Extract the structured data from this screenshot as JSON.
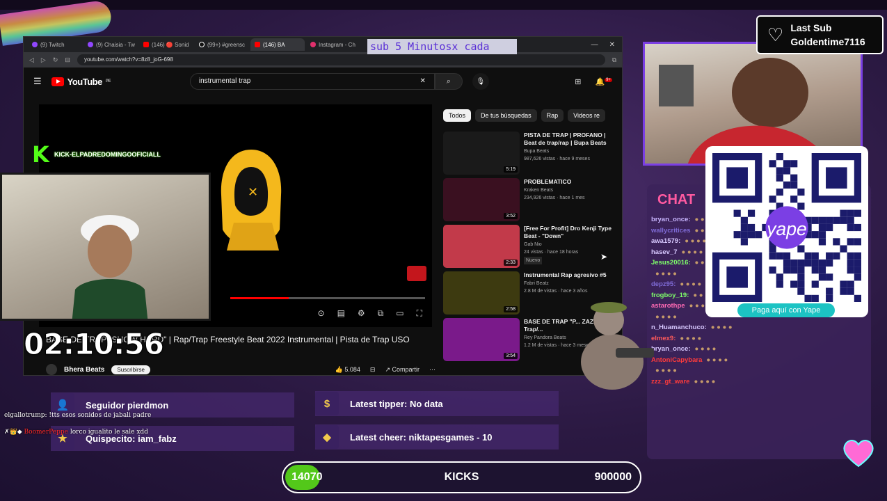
{
  "browser": {
    "tabs": [
      {
        "label": "(9) Twitch",
        "kind": "twitch"
      },
      {
        "label": "(9) Chaisia - Tw",
        "kind": "twitch"
      },
      {
        "label": "(146) 🔴 Sonid",
        "kind": "yt"
      },
      {
        "label": "(99+) #greensc",
        "kind": "tk"
      },
      {
        "label": "(146) BA",
        "kind": "yt",
        "active": true
      },
      {
        "label": "Instagram - Ch",
        "kind": "ig"
      }
    ],
    "url": "youtube.com/watch?v=8z8_joG-698",
    "overlay_text": "sub 5 Minutosx cada"
  },
  "youtube": {
    "logo_text": "YouTube",
    "logo_region": "PE",
    "search_value": "instrumental trap",
    "notification_count": "9+",
    "video_title": "BASE DE TRAP \"SHOW HARD\" | Rap/Trap Freestyle Beat 2022 Instrumental | Pista de Trap USO",
    "channel_name": "Bhera Beats",
    "subscribe_label": "Suscribirse",
    "likes": "5.084",
    "share_label": "Compartir",
    "chips": [
      "Todos",
      "De tus búsquedas",
      "Rap",
      "Videos re"
    ],
    "recommendations": [
      {
        "title": "PISTA DE TRAP | PROFANO | Beat de trap/rap | Bupa Beats",
        "channel": "Bupa Beats",
        "meta": "987,626 vistas · hace 9 meses",
        "duration": "5:19",
        "color": "#1a1a1a"
      },
      {
        "title": "PROBLEMATICO",
        "channel": "Kraken Beats",
        "meta": "234,926 vistas · hace 1 mes",
        "duration": "3:52",
        "color": "#3a1020"
      },
      {
        "title": "[Free For Profit] Dro Kenji Type Beat - \"Down\"",
        "channel": "Gab Nio",
        "meta": "24 vistas · hace 18 horas",
        "duration": "2:33",
        "color": "#c23a4a",
        "badge": "Nuevo"
      },
      {
        "title": "Instrumental Rap agresivo #5",
        "channel": "Fabri Beatz",
        "meta": "2.8 M de vistas · hace 3 años",
        "duration": "2:58",
        "color": "#3d3a10"
      },
      {
        "title": "BASE DE TRAP \"P... ZAZA\" | Trap/...",
        "channel": "Rey Pandora Beats",
        "meta": "1.2 M de vistas · hace 3 meses",
        "duration": "3:54",
        "color": "#7a1a8a"
      }
    ]
  },
  "stream": {
    "kick_channel": "KICK-ELPADREDOMINGOOFICIALL",
    "timer": "02:10:56",
    "last_sub_label": "Last Sub",
    "last_sub_name": "Goldentime7116",
    "yape_label": "Paga aquí con Yape",
    "chat_title": "CHAT",
    "chat_lines": [
      {
        "user": "bryan_once:",
        "color": "#c9b6ff"
      },
      {
        "user": "wallycritices",
        "color": "#7f6bd6"
      },
      {
        "user": "awa1579:",
        "color": "#d8c9ff"
      },
      {
        "user": "hasev_7",
        "color": "#d8c9ff"
      },
      {
        "user": "Jesus20016:",
        "color": "#7fff6a"
      },
      {
        "user": "",
        "color": "#d8c9ff"
      },
      {
        "user": "depz95:",
        "color": "#7f6bd6"
      },
      {
        "user": "frogboy_19:",
        "color": "#7fff6a"
      },
      {
        "user": "astarothpe",
        "color": "#ff6ab4"
      },
      {
        "user": "",
        "color": "#d8c9ff"
      },
      {
        "user": "n_Huamanchuco:",
        "color": "#d8c9ff"
      },
      {
        "user": "elmex9:",
        "color": "#ff5a5a"
      },
      {
        "user": "bryan_once:",
        "color": "#d8c9ff"
      },
      {
        "user": "AntoniCapybara",
        "color": "#ff3b3b"
      },
      {
        "user": "",
        "color": "#d8c9ff"
      },
      {
        "user": "zzz_gt_ware",
        "color": "#ff3b3b"
      }
    ],
    "follower_text": "Seguidor pierdmon",
    "sub_text": "Quispecito: iam_fabz",
    "tipper_text": "Latest tipper: No data",
    "cheer_text": "Latest cheer: niktapesgames - 10",
    "overlay_chat_1": "elgallotrump: !tts esos sonidos de jabali padre",
    "overlay_chat_2_user": "BoomerPeppe",
    "overlay_chat_2_msg": "lorco igualito le sale xdd",
    "kicks_current": "14070",
    "kicks_label": "KICKS",
    "kicks_goal": "900000",
    "kicks_progress": 0.0156
  },
  "colors": {
    "kick_green": "#53fc18",
    "yt_red": "#ff0000",
    "accent_purple": "#7b3fe4",
    "yape_teal": "#1cc3c3"
  }
}
